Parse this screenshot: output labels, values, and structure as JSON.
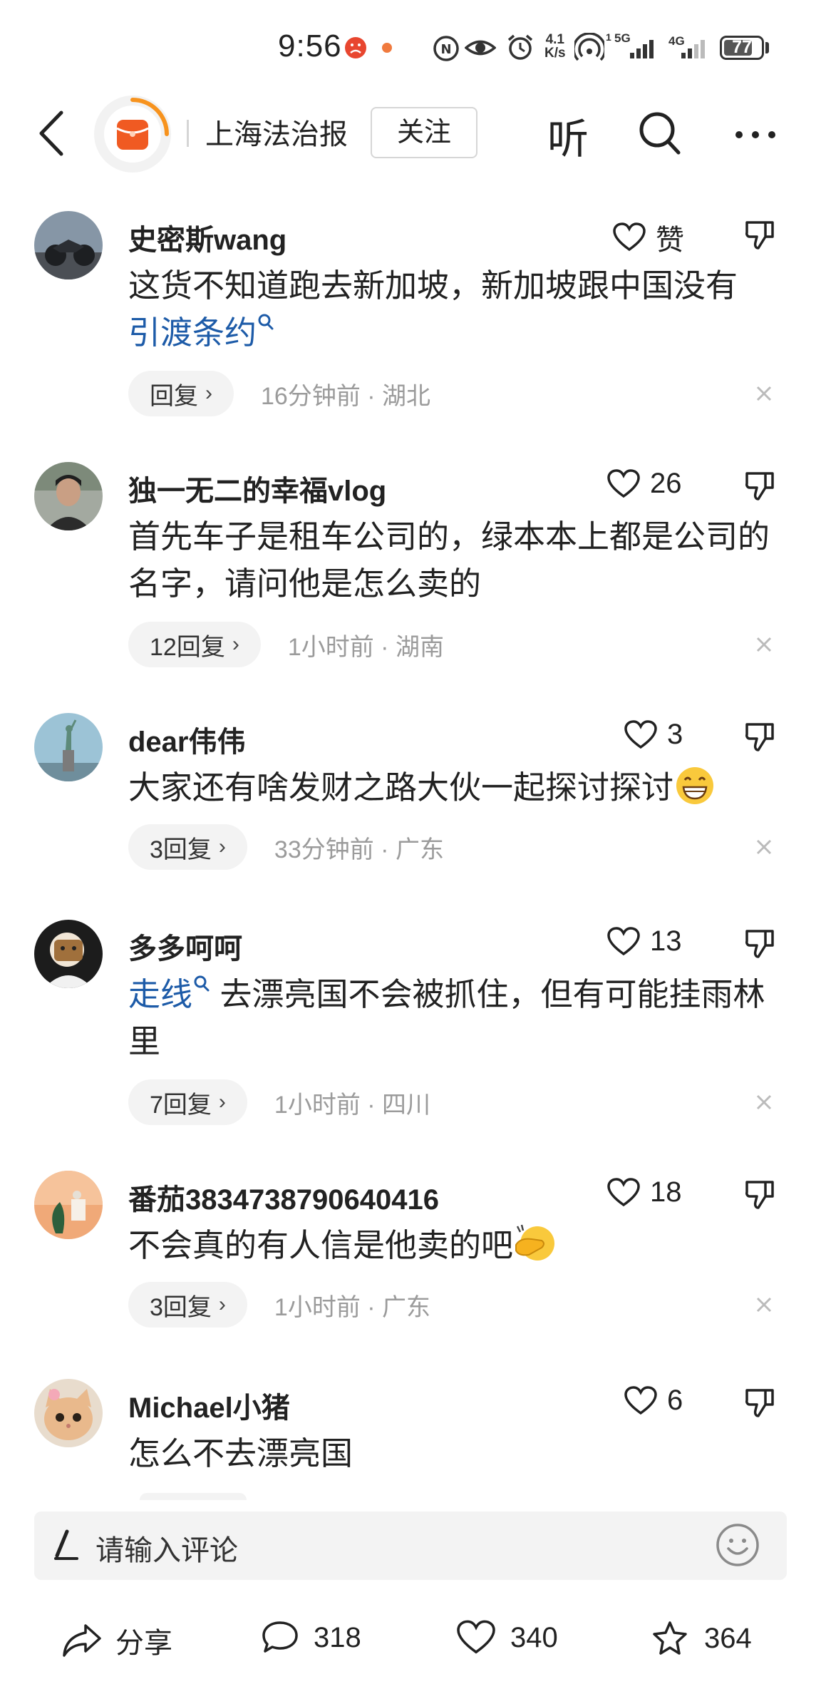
{
  "status_bar": {
    "time": "9:56",
    "speed": "4.1",
    "speed_unit": "K/s",
    "net1": "5G",
    "net2": "4G",
    "battery": "77",
    "battery_level": 0.77
  },
  "header": {
    "account_name": "上海法治报",
    "follow_label": "关注",
    "listen_label": "听"
  },
  "comments": [
    {
      "user": "史密斯wang",
      "likes": "赞",
      "text_plain": "这货不知道跑去新加坡，新加坡跟中国没有",
      "text_link": "引渡条约",
      "replies": "回复",
      "time_loc": "16分钟前 · 湖北"
    },
    {
      "user": "独一无二的幸福vlog",
      "likes": "26",
      "text_plain": "首先车子是租车公司的，绿本本上都是公司的名字，请问他是怎么卖的",
      "replies": "12回复",
      "time_loc": "1小时前 · 湖南"
    },
    {
      "user": "dear伟伟",
      "likes": "3",
      "text_plain": "大家还有啥发财之路大伙一起探讨探讨",
      "replies": "3回复",
      "time_loc": "33分钟前 · 广东"
    },
    {
      "user": "多多呵呵",
      "likes": "13",
      "text_link": "走线",
      "text_plain": " 去漂亮国不会被抓住，但有可能挂雨林里",
      "replies": "7回复",
      "time_loc": "1小时前 · 四川"
    },
    {
      "user": "番茄3834738790640416",
      "likes": "18",
      "text_plain": "不会真的有人信是他卖的吧",
      "replies": "3回复",
      "time_loc": "1小时前 · 广东"
    },
    {
      "user": "Michael小猪",
      "likes": "6",
      "text_plain": "怎么不去漂亮国"
    }
  ],
  "input": {
    "placeholder": "请输入评论"
  },
  "bottom_bar": {
    "share_label": "分享",
    "comment_count": "318",
    "like_count": "340",
    "fav_count": "364"
  },
  "colors": {
    "link": "#1d5ba8",
    "logo": "#f05a22",
    "muted": "#9b9b9b"
  }
}
